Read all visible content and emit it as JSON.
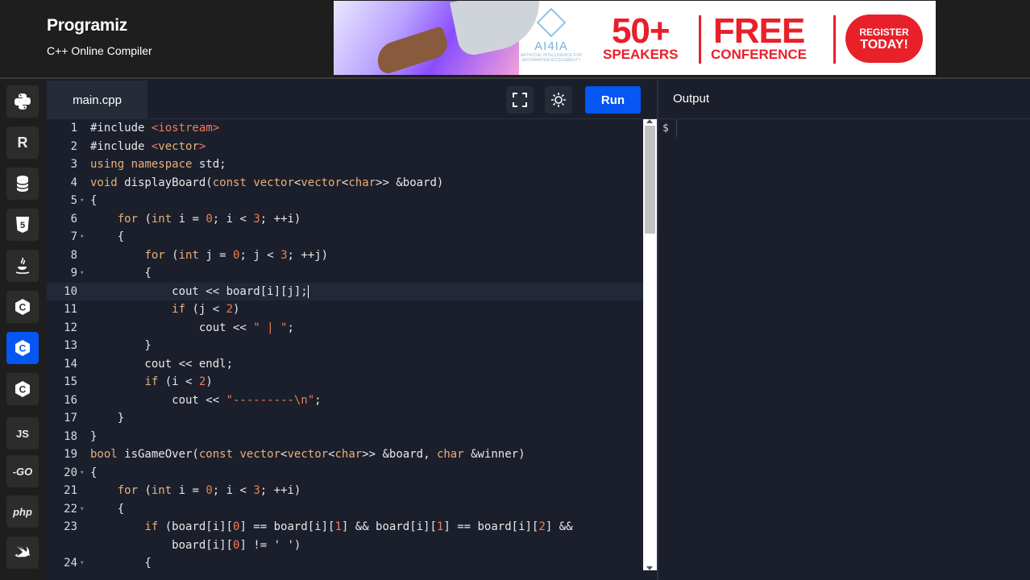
{
  "header": {
    "logo": "Programiz",
    "subtitle": "C++ Online Compiler"
  },
  "banner": {
    "brand": "AI4IA",
    "brand_small": "ARTIFICIAL INTELLIGENCE FOR INFORMATION ACCESSIBILITY",
    "speakers_count": "50+",
    "speakers_label": "SPEAKERS",
    "free": "FREE",
    "conference": "CONFERENCE",
    "register_a": "REGISTER",
    "register_b": "TODAY!"
  },
  "sidebar": {
    "items": [
      {
        "name": "python",
        "icon": "python-icon",
        "label": ""
      },
      {
        "name": "r",
        "icon": "r-icon",
        "label": "R"
      },
      {
        "name": "sql",
        "icon": "database-icon",
        "label": ""
      },
      {
        "name": "html",
        "icon": "html5-icon",
        "label": "5"
      },
      {
        "name": "java",
        "icon": "java-icon",
        "label": ""
      },
      {
        "name": "c",
        "icon": "c-icon",
        "label": "C"
      },
      {
        "name": "cpp",
        "icon": "cpp-icon",
        "label": "C"
      },
      {
        "name": "csharp",
        "icon": "csharp-icon",
        "label": "C"
      },
      {
        "name": "javascript",
        "icon": "js-icon",
        "label": "JS"
      },
      {
        "name": "go",
        "icon": "go-icon",
        "label": "-GO"
      },
      {
        "name": "php",
        "icon": "php-icon",
        "label": "php"
      },
      {
        "name": "swift",
        "icon": "swift-icon",
        "label": ""
      }
    ],
    "active_index": 6
  },
  "editor": {
    "tab_label": "main.cpp",
    "run_label": "Run",
    "lines": [
      {
        "n": "1",
        "fold": "",
        "code": "#include <iostream>"
      },
      {
        "n": "2",
        "fold": "",
        "code": "#include <vector>"
      },
      {
        "n": "3",
        "fold": "",
        "code": "using namespace std;"
      },
      {
        "n": "4",
        "fold": "",
        "code": "void displayBoard(const vector<vector<char>> &board)"
      },
      {
        "n": "5",
        "fold": "▾",
        "code": "{"
      },
      {
        "n": "6",
        "fold": "",
        "code": "    for (int i = 0; i < 3; ++i)"
      },
      {
        "n": "7",
        "fold": "▾",
        "code": "    {"
      },
      {
        "n": "8",
        "fold": "",
        "code": "        for (int j = 0; j < 3; ++j)"
      },
      {
        "n": "9",
        "fold": "▾",
        "code": "        {"
      },
      {
        "n": "10",
        "fold": "",
        "code": "            cout << board[i][j];"
      },
      {
        "n": "11",
        "fold": "",
        "code": "            if (j < 2)"
      },
      {
        "n": "12",
        "fold": "",
        "code": "                cout << \" | \";"
      },
      {
        "n": "13",
        "fold": "",
        "code": "        }"
      },
      {
        "n": "14",
        "fold": "",
        "code": "        cout << endl;"
      },
      {
        "n": "15",
        "fold": "",
        "code": "        if (i < 2)"
      },
      {
        "n": "16",
        "fold": "",
        "code": "            cout << \"---------\\n\";"
      },
      {
        "n": "17",
        "fold": "",
        "code": "    }"
      },
      {
        "n": "18",
        "fold": "",
        "code": "}"
      },
      {
        "n": "19",
        "fold": "",
        "code": "bool isGameOver(const vector<vector<char>> &board, char &winner)"
      },
      {
        "n": "20",
        "fold": "▾",
        "code": "{"
      },
      {
        "n": "21",
        "fold": "",
        "code": "    for (int i = 0; i < 3; ++i)"
      },
      {
        "n": "22",
        "fold": "▾",
        "code": "    {"
      },
      {
        "n": "23",
        "fold": "",
        "code": "        if (board[i][0] == board[i][1] && board[i][1] == board[i][2] &&"
      },
      {
        "n": "",
        "fold": "",
        "code": "            board[i][0] != ' ')"
      },
      {
        "n": "24",
        "fold": "▾",
        "code": "        {"
      }
    ],
    "active_line": 9
  },
  "output": {
    "title": "Output",
    "prompt": "$"
  },
  "colors": {
    "accent": "#0556f3",
    "editor_bg": "#1b1f2b",
    "keyword": "#e8b07a",
    "string": "#f07c5a",
    "number": "#f07c5a"
  }
}
